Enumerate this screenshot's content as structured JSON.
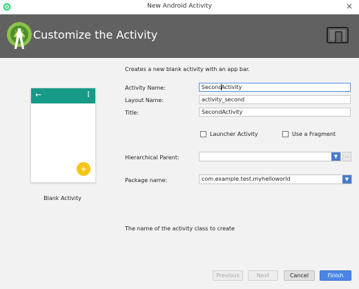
{
  "window": {
    "title": "New Android Activity",
    "close_label": "×"
  },
  "header": {
    "title": "Customize the Activity"
  },
  "template": {
    "name": "Blank Activity",
    "back_glyph": "←",
    "menu_glyph": "⋮",
    "fab_glyph": "+"
  },
  "form": {
    "description": "Creates a new blank activity with an app bar.",
    "activity_name": {
      "label": "Activity Name:",
      "value_before_cursor": "Second",
      "value_after_cursor": "Activity"
    },
    "layout_name": {
      "label": "Layout Name:",
      "value": "activity_second"
    },
    "title": {
      "label": "Title:",
      "value": "SecondActivity"
    },
    "launcher_activity": {
      "label": "Launcher Activity",
      "checked": false
    },
    "use_fragment": {
      "label": "Use a Fragment",
      "checked": false
    },
    "hierarchical_parent": {
      "label": "Hierarchical Parent:",
      "value": "",
      "browse_label": "..."
    },
    "package_name": {
      "label": "Package name:",
      "value": "com.example.test.myhelloworld"
    },
    "hint": "The name of the activity class to create",
    "dropdown_arrow": "▼"
  },
  "buttons": {
    "previous": "Previous",
    "next": "Next",
    "cancel": "Cancel",
    "finish": "Finish"
  },
  "colors": {
    "header_bg": "#616161",
    "app_bar": "#179b88",
    "fab": "#f5c518",
    "primary_button": "#4a86e8"
  }
}
